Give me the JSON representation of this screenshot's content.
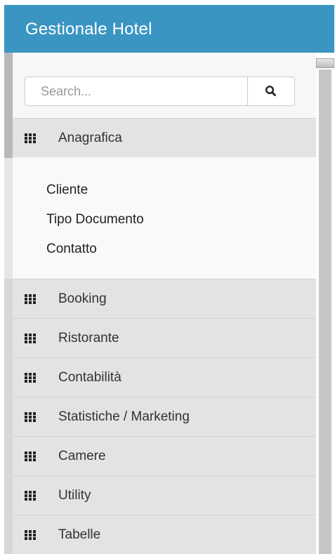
{
  "header": {
    "title": "Gestionale Hotel",
    "background_color": "#3a95c2"
  },
  "search": {
    "placeholder": "Search...",
    "value": "",
    "button_icon": "search-icon"
  },
  "menu": {
    "item_icon": "grid-icon",
    "items": [
      {
        "label": "Anagrafica",
        "expanded": true
      },
      {
        "label": "Booking"
      },
      {
        "label": "Ristorante"
      },
      {
        "label": "Contabilità"
      },
      {
        "label": "Statistiche / Marketing"
      },
      {
        "label": "Camere"
      },
      {
        "label": "Utility"
      },
      {
        "label": "Tabelle"
      }
    ],
    "submenu": [
      {
        "label": "Cliente"
      },
      {
        "label": "Tipo Documento"
      },
      {
        "label": "Contatto"
      }
    ]
  }
}
